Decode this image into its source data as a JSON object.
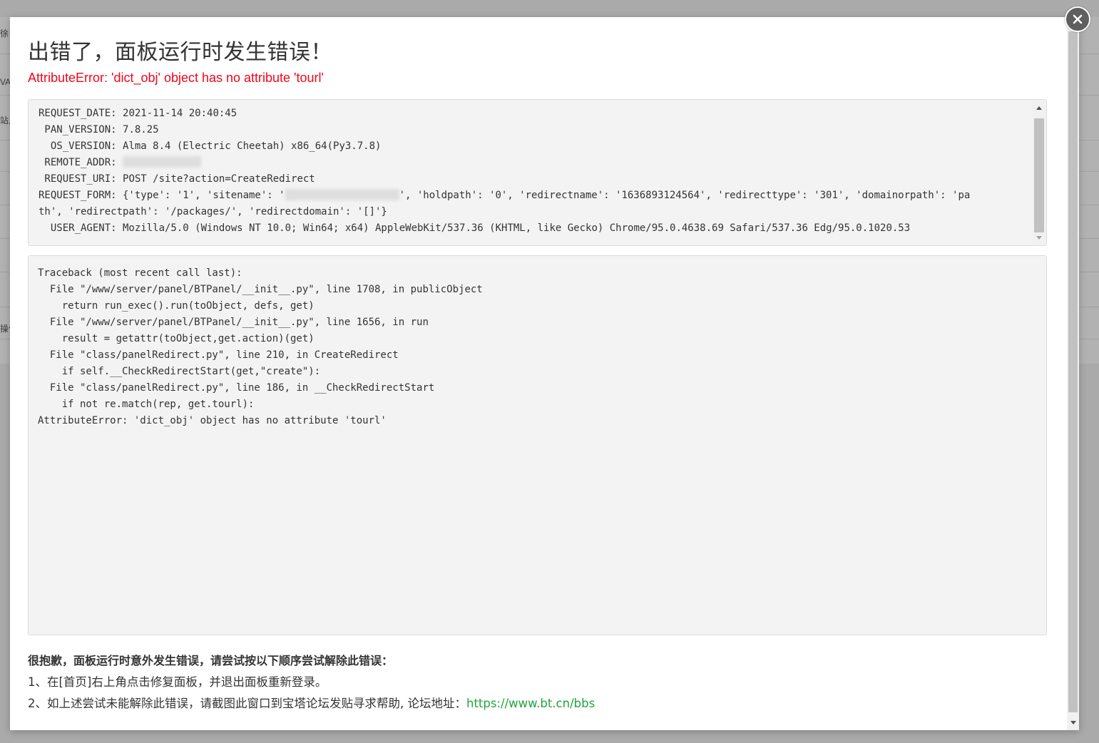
{
  "background": {
    "fragments": [
      "徐自",
      "VA",
      "站点",
      "操作"
    ]
  },
  "dialog": {
    "title": "出错了，面板运行时发生错误！",
    "error_summary": "AttributeError: 'dict_obj' object has no attribute 'tourl'",
    "request_info": {
      "lines": [
        {
          "label": "REQUEST_DATE: ",
          "value": "2021-11-14 20:40:45"
        },
        {
          "label": " PAN_VERSION: ",
          "value": "7.8.25"
        },
        {
          "label": "  OS_VERSION: ",
          "value": "Alma 8.4 (Electric Cheetah) x86_64(Py3.7.8)"
        },
        {
          "label": " REMOTE_ADDR: ",
          "value": ""
        },
        {
          "label": " REQUEST_URI: ",
          "value": "POST /site?action=CreateRedirect"
        }
      ],
      "form_prefix": "REQUEST_FORM: {'type': '1', 'sitename': '",
      "form_suffix": "', 'holdpath': '0', 'redirectname': '1636893124564', 'redirecttype': '301', 'domainorpath': 'pa",
      "form_line2": "th', 'redirectpath': '/packages/', 'redirectdomain': '[]'}",
      "user_agent": "  USER_AGENT: Mozilla/5.0 (Windows NT 10.0; Win64; x64) AppleWebKit/537.36 (KHTML, like Gecko) Chrome/95.0.4638.69 Safari/537.36 Edg/95.0.1020.53"
    },
    "traceback": [
      "Traceback (most recent call last):",
      "  File \"/www/server/panel/BTPanel/__init__.py\", line 1708, in publicObject",
      "    return run_exec().run(toObject, defs, get)",
      "  File \"/www/server/panel/BTPanel/__init__.py\", line 1656, in run",
      "    result = getattr(toObject,get.action)(get)",
      "  File \"class/panelRedirect.py\", line 210, in CreateRedirect",
      "    if self.__CheckRedirectStart(get,\"create\"):",
      "  File \"class/panelRedirect.py\", line 186, in __CheckRedirectStart",
      "    if not re.match(rep, get.tourl):",
      "AttributeError: 'dict_obj' object has no attribute 'tourl'"
    ],
    "help": {
      "heading": "很抱歉，面板运行时意外发生错误，请尝试按以下顺序尝试解除此错误：",
      "step1": "1、在[首页]右上角点击修复面板，并退出面板重新登录。",
      "step2_prefix": "2、如上述尝试未能解除此错误，请截图此窗口到宝塔论坛发贴寻求帮助, 论坛地址：",
      "forum_url": "https://www.bt.cn/bbs"
    },
    "close_icon": "close-icon",
    "colors": {
      "error_red": "#f2051b",
      "link_green": "#20a53a",
      "close_bg": "#5f5f5f"
    }
  }
}
